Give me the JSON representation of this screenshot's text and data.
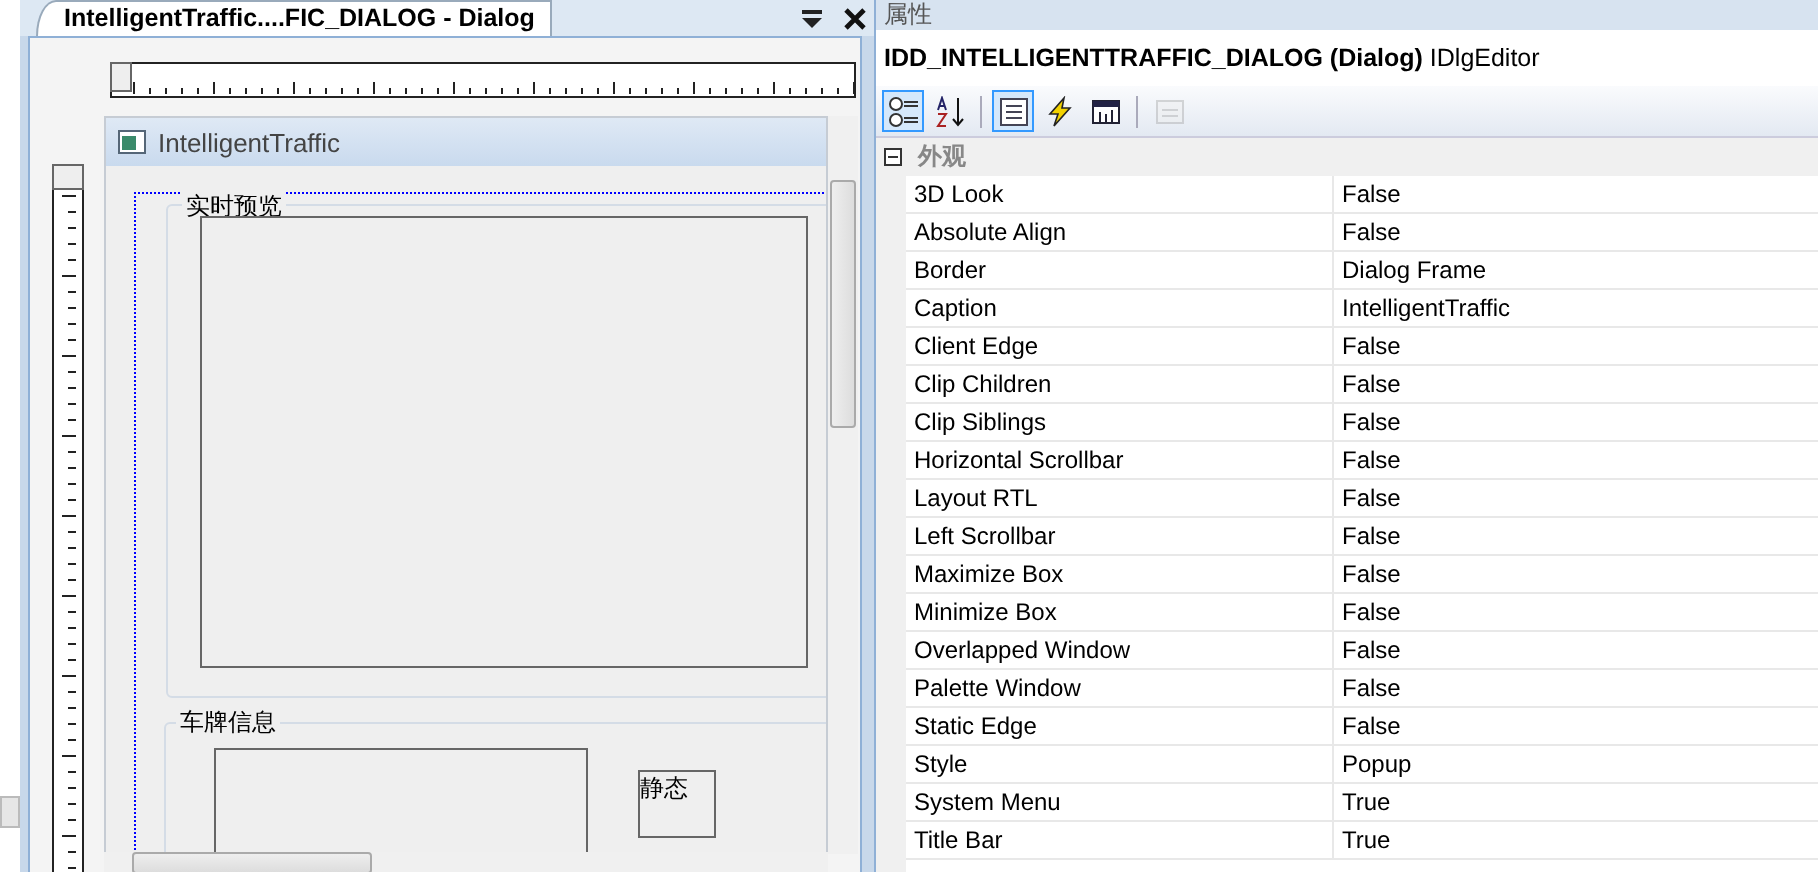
{
  "document_tab": {
    "title": "IntelligentTraffic....FIC_DIALOG - Dialog"
  },
  "dialog": {
    "title": "IntelligentTraffic",
    "preview_group": "实时预览",
    "plate_group": "车牌信息",
    "static_text": "静态"
  },
  "properties": {
    "panel_title": "属性",
    "object_name": "IDD_INTELLIGENTTRAFFIC_DIALOG (Dialog)",
    "object_type": "IDlgEditor",
    "toolbar_groups": [
      [
        {
          "kind": "categorized",
          "selected": true,
          "disabled": false
        },
        {
          "kind": "alphabetical",
          "selected": false,
          "disabled": false
        }
      ],
      [
        {
          "kind": "properties",
          "selected": true,
          "disabled": false
        },
        {
          "kind": "events",
          "selected": false,
          "disabled": false
        },
        {
          "kind": "messages",
          "selected": false,
          "disabled": false
        }
      ],
      [
        {
          "kind": "pages",
          "selected": false,
          "disabled": true
        }
      ]
    ],
    "category": {
      "label": "外观",
      "expanded": true
    },
    "rows": [
      {
        "name": "3D Look",
        "value": "False"
      },
      {
        "name": "Absolute Align",
        "value": "False"
      },
      {
        "name": "Border",
        "value": "Dialog Frame"
      },
      {
        "name": "Caption",
        "value": "IntelligentTraffic"
      },
      {
        "name": "Client Edge",
        "value": "False"
      },
      {
        "name": "Clip Children",
        "value": "False"
      },
      {
        "name": "Clip Siblings",
        "value": "False"
      },
      {
        "name": "Horizontal Scrollbar",
        "value": "False"
      },
      {
        "name": "Layout RTL",
        "value": "False"
      },
      {
        "name": "Left Scrollbar",
        "value": "False"
      },
      {
        "name": "Maximize Box",
        "value": "False"
      },
      {
        "name": "Minimize Box",
        "value": "False"
      },
      {
        "name": "Overlapped Window",
        "value": "False"
      },
      {
        "name": "Palette Window",
        "value": "False"
      },
      {
        "name": "Static Edge",
        "value": "False"
      },
      {
        "name": "Style",
        "value": "Popup"
      },
      {
        "name": "System Menu",
        "value": "True"
      },
      {
        "name": "Title Bar",
        "value": "True"
      }
    ]
  }
}
